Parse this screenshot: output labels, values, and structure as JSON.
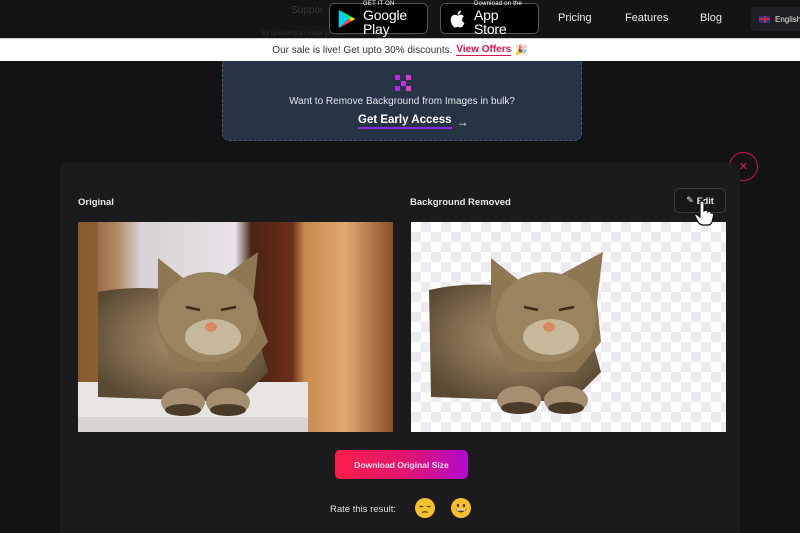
{
  "topnav": {
    "faded_text_1": "Suppor",
    "faded_text_2": "By uploading an image you agree to our Terms of Service",
    "google_play": {
      "small": "GET IT ON",
      "big": "Google Play"
    },
    "app_store": {
      "small": "Download on the",
      "big": "App Store"
    },
    "links": [
      "Pricing",
      "Features",
      "Blog"
    ],
    "language": "English"
  },
  "sale_banner": {
    "text": "Our sale is live! Get upto 30% discounts.",
    "link": "View Offers",
    "icon": "party-popper-icon"
  },
  "bulk_card": {
    "icon": "bulk-grid-icon",
    "text": "Want to Remove Background from Images in bulk?",
    "cta": "Get Early Access",
    "cta_arrow": "→"
  },
  "close_button": {
    "glyph": "✕"
  },
  "result": {
    "original_label": "Original",
    "removed_label": "Background Removed",
    "edit_label": "Edit",
    "edit_icon": "pencil-icon",
    "download_label": "Download Original Size",
    "rate_label": "Rate this result:",
    "ratings": [
      "unamused-face",
      "grinning-face"
    ]
  },
  "colors": {
    "accent_pink": "#d8134f",
    "cta_underline": "#8a2be2",
    "download_gradient": [
      "#ff1c4a",
      "#b10ad0"
    ],
    "card_bg": "#273445",
    "page_bg": "#131315"
  }
}
